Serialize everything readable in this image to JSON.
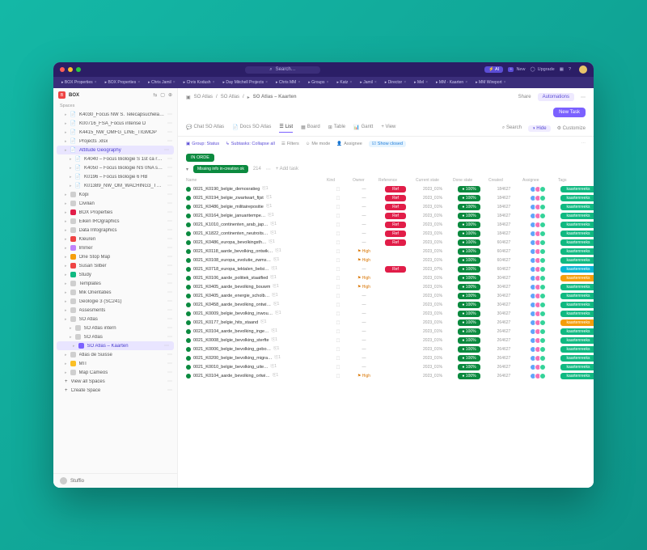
{
  "top": {
    "search_placeholder": "Search…",
    "ai_pill": "⚡ AI",
    "new_label": "New",
    "upgrade_label": "Upgrade"
  },
  "purple_tabs": [
    "BOX Properties",
    "BOX Properties",
    "Chris Jamil",
    "Chris Kodush",
    "Day Mitchell Projects",
    "Chris MM",
    "Groups",
    "Katz",
    "Jamil",
    "Director",
    "Mel",
    "MM - Kaarten",
    "MM Wireport"
  ],
  "workspace": {
    "code": "B",
    "name": "BOX"
  },
  "sidebar_icons": [
    "⇆",
    "□",
    "⊕"
  ],
  "sidebar_label": "Spaces",
  "sidebar": [
    {
      "type": "doc",
      "label": "K4030_Focus NW S. Telecapsuchela…"
    },
    {
      "type": "doc",
      "label": "K00716_FSA_Focus intense D"
    },
    {
      "type": "doc",
      "label": "K4415_NW_OMFG_LINE_TIGMOP"
    },
    {
      "type": "doc",
      "label": "Projects .xlsx"
    },
    {
      "type": "doc",
      "label": "Attitude Geography",
      "sel": true
    },
    {
      "type": "doc",
      "label": "K4040 – Focus Biologie S 1st ca re…",
      "nested": true
    },
    {
      "type": "doc",
      "label": "K4050 – Focus Biologie NS 0NA s…",
      "nested": true
    },
    {
      "type": "doc",
      "label": "K0196 – Focus Biologie 6 HB",
      "nested": true
    },
    {
      "type": "doc",
      "label": "K01389_NW_OM_WACHING3_TS_v1",
      "nested": true
    },
    {
      "type": "item",
      "ico": "◻",
      "color": "#cfcfcf",
      "label": "Kopi"
    },
    {
      "type": "item",
      "ico": "◻",
      "color": "#cfcfcf",
      "label": "Civilian"
    },
    {
      "type": "item",
      "ico": "●",
      "color": "#e11d48",
      "label": "BOX Properties"
    },
    {
      "type": "item",
      "ico": "◻",
      "color": "#cfcfcf",
      "label": "Eiken IROgraphics"
    },
    {
      "type": "item",
      "ico": "◻",
      "color": "#cfcfcf",
      "label": "Data Infographics"
    },
    {
      "type": "item",
      "ico": "■",
      "color": "#ef4444",
      "label": "Kleuren"
    },
    {
      "type": "item",
      "ico": "■",
      "color": "#c084fc",
      "label": "Immer"
    },
    {
      "type": "item",
      "ico": "■",
      "color": "#f59e0b",
      "label": "One Stop Map"
    },
    {
      "type": "item",
      "ico": "■",
      "color": "#ef4444",
      "label": "Susan Silber"
    },
    {
      "type": "item",
      "ico": "■",
      "color": "#10b981",
      "label": "Study"
    },
    {
      "type": "item",
      "ico": "◻",
      "color": "#cfcfcf",
      "label": "Templates"
    },
    {
      "type": "item",
      "ico": "◻",
      "color": "#cfcfcf",
      "label": "Mik Orientaties"
    },
    {
      "type": "item",
      "ico": "◻",
      "color": "#cfcfcf",
      "label": "Geologie 3 (SC241)"
    },
    {
      "type": "item",
      "ico": "◻",
      "color": "#cfcfcf",
      "label": "Assesments"
    },
    {
      "type": "item",
      "ico": "◻",
      "color": "#cfcfcf",
      "label": "SO Atlas"
    },
    {
      "type": "item",
      "ico": "◻",
      "color": "#cfcfcf",
      "label": "SO Atlas intern",
      "nested": true
    },
    {
      "type": "item",
      "ico": "◻",
      "color": "#cfcfcf",
      "label": "SO Atlas",
      "nested": true
    },
    {
      "type": "item",
      "ico": "●",
      "color": "#7b61ff",
      "label": "SO Atlas – Kaarten",
      "nested": true,
      "sel": true
    },
    {
      "type": "item",
      "ico": "◻",
      "color": "#cfcfcf",
      "label": "Atlas de Suisse"
    },
    {
      "type": "item",
      "ico": "■",
      "color": "#fbbf24",
      "label": "MIT"
    },
    {
      "type": "item",
      "ico": "◻",
      "color": "#cfcfcf",
      "label": "Map Cameos"
    },
    {
      "type": "link",
      "label": "View all Spaces"
    },
    {
      "type": "link",
      "label": "Create Space"
    }
  ],
  "footer_name": "Stuffio",
  "crumbs": [
    "SO Atlas",
    "SO Atlas",
    "SO Atlas – Kaarten"
  ],
  "crumb_actions": {
    "share": "Share",
    "automations": "Automations"
  },
  "new_task": "New Task",
  "viewtabs": {
    "items": [
      "Chat SO Atlas",
      "Docs SO Atlas",
      "List",
      "Board",
      "Table",
      "Gantt"
    ],
    "add": "+ View",
    "active_index": 2,
    "right": {
      "search": "Search",
      "hide": "Hide",
      "customize": "Customize"
    }
  },
  "filters": {
    "group": "Group: Status",
    "subtasks": "Subtasks: Collapse all",
    "filters": "Filters",
    "me": "Me mode",
    "assignee": "Assignee",
    "showclosed": "Show closed"
  },
  "status_chip": "IN ORDE",
  "group_header": {
    "label": "Missing info in-creation ok",
    "count": "214",
    "add": "+ Add task"
  },
  "columns": [
    "Name",
    "Kind",
    "Owner",
    "Reference",
    "Current state",
    "Done state",
    "Created",
    "Assignee",
    "Tags"
  ],
  "rows": [
    {
      "name": "0021_K0190_belgie_demosratieg",
      "ref": true,
      "prio": "",
      "cur": "2023_01%",
      "date": "184627",
      "tag": "green"
    },
    {
      "name": "0021_K0194_belgie_zwartwart_fijst",
      "ref": true,
      "prio": "",
      "cur": "2023_01%",
      "date": "184627",
      "tag": "green"
    },
    {
      "name": "0021_K0486_belgie_militairepositie",
      "ref": true,
      "prio": "",
      "cur": "2023_01%",
      "date": "184627",
      "tag": "green"
    },
    {
      "name": "0021_K0164_belgie_januaritempe…",
      "ref": true,
      "prio": "",
      "cur": "2023_01%",
      "date": "184627",
      "tag": "green"
    },
    {
      "name": "0021_K1010_continenten_arab_jap…",
      "ref": true,
      "prio": "",
      "cur": "2023_01%",
      "date": "184627",
      "tag": "green"
    },
    {
      "name": "0021_K1822_continenten_neutroits…",
      "ref": true,
      "prio": "",
      "cur": "2023_01%",
      "date": "184627",
      "tag": "green"
    },
    {
      "name": "0021_K0486_europa_bevolkingsth…",
      "ref": true,
      "prio": "",
      "cur": "2023_01%",
      "date": "604627",
      "tag": "green"
    },
    {
      "name": "0021_K0118_aarde_bevolking_ontwik…",
      "ref": false,
      "prio": "High",
      "cur": "2023_01%",
      "date": "604627",
      "tag": "green"
    },
    {
      "name": "0021_K0108_europa_evolutie_zwms…",
      "ref": false,
      "prio": "High",
      "cur": "2023_01%",
      "date": "604627",
      "tag": "green"
    },
    {
      "name": "0021_K0718_europa_tektalen_belsi…",
      "ref": true,
      "prio": "",
      "cur": "2023_07%",
      "date": "604627",
      "tag": "teal"
    },
    {
      "name": "0021_K0106_aarde_politiek_staatfied",
      "ref": false,
      "prio": "High",
      "cur": "2023_01%",
      "date": "304627",
      "tag": "yellow"
    },
    {
      "name": "0021_K0405_aarde_bevolking_bouwm",
      "ref": false,
      "prio": "High",
      "cur": "2023_01%",
      "date": "304627",
      "tag": "green"
    },
    {
      "name": "0021_K0405_aarde_energie_scholb…",
      "ref": false,
      "prio": "",
      "cur": "2023_01%",
      "date": "304627",
      "tag": "green"
    },
    {
      "name": "0021_K0458_aarde_bevolking_ontwi…",
      "ref": false,
      "prio": "",
      "cur": "2023_01%",
      "date": "304627",
      "tag": "green"
    },
    {
      "name": "0021_K0009_belgie_bevolking_inwou…",
      "ref": false,
      "prio": "",
      "cur": "2023_01%",
      "date": "304627",
      "tag": "green"
    },
    {
      "name": "0021_K0177_belgie_hits_staand",
      "ref": false,
      "prio": "",
      "cur": "2023_01%",
      "date": "264627",
      "tag": "yellow"
    },
    {
      "name": "0021_K0104_aarde_bevolking_inge…",
      "ref": false,
      "prio": "",
      "cur": "2023_01%",
      "date": "264627",
      "tag": "green"
    },
    {
      "name": "0021_K0008_belgie_bevolking_sterfte",
      "ref": false,
      "prio": "",
      "cur": "2023_01%",
      "date": "264627",
      "tag": "green"
    },
    {
      "name": "0021_K0006_belgie_bevolking_gebo…",
      "ref": false,
      "prio": "",
      "cur": "2023_01%",
      "date": "264627",
      "tag": "green"
    },
    {
      "name": "0021_K0200_belgie_bevolking_migra…",
      "ref": false,
      "prio": "",
      "cur": "2023_01%",
      "date": "264627",
      "tag": "green"
    },
    {
      "name": "0021_K0010_belgie_bevolking_uite…",
      "ref": false,
      "prio": "",
      "cur": "2023_01%",
      "date": "264627",
      "tag": "green"
    },
    {
      "name": "0021_K0104_aarde_bevolking_ortwi…",
      "ref": false,
      "prio": "High",
      "cur": "2023_01%",
      "date": "264627",
      "tag": "green"
    }
  ],
  "avatar_colors": [
    "#60a5fa",
    "#f472b6",
    "#34d399"
  ]
}
